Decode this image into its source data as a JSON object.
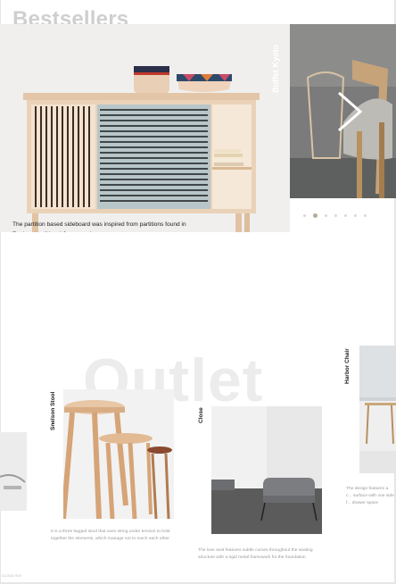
{
  "bestsellers": {
    "title": "Bestsellers",
    "hero_caption": "The partition based sideboard was inspired from partitions found in Ryokan: traditional Japanese inns",
    "side_item_title": "Buffet Kyoto",
    "next_icon": "chevron-right-icon",
    "pagination": {
      "count": 7,
      "active_index": 1
    }
  },
  "outlet": {
    "background_word": "Outlet",
    "cards": [
      {
        "title": "Snelson Stool",
        "description": "It is a three legged stool that uses string under tension to hold together the elements, which manage not to touch each other"
      },
      {
        "title": "Close",
        "description": "The love seat features subtle curves throughout the seating structure with a rigid metal framework for the foundation"
      },
      {
        "title": "Harbor Chair",
        "description": "The design features a c... surface with one side f... drawer space"
      }
    ]
  },
  "footer_note": "CLOUD 909"
}
